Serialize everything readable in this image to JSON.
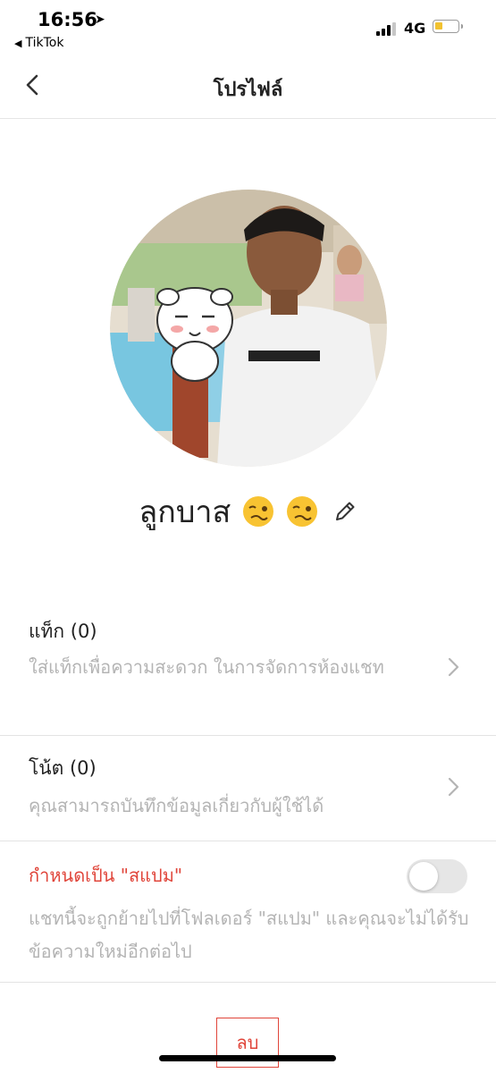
{
  "status_bar": {
    "time": "16:56",
    "location_glyph": "➤",
    "back_app": "TikTok",
    "network": "4G"
  },
  "nav": {
    "title": "โปรไฟล์"
  },
  "profile": {
    "name": "ลูกบาส"
  },
  "tag": {
    "title": "แท็ก (0)",
    "description": "ใส่แท็กเพื่อความสะดวก ในการจัดการห้องแชท"
  },
  "note": {
    "title": "โน้ต (0)",
    "description": "คุณสามารถบันทึกข้อมูลเกี่ยวกับผู้ใช้ได้"
  },
  "spam": {
    "title": "กำหนดเป็น \"สแปม\"",
    "description": "แชทนี้จะถูกย้ายไปที่โฟลเดอร์ \"สแปม\" และคุณจะไม่ได้รับข้อความใหม่อีกต่อไป",
    "enabled": false
  },
  "actions": {
    "delete_label": "ลบ"
  },
  "colors": {
    "danger": "#e0453a",
    "muted_text": "#b4b4b4",
    "toggle_off": "#e6e6e6"
  }
}
